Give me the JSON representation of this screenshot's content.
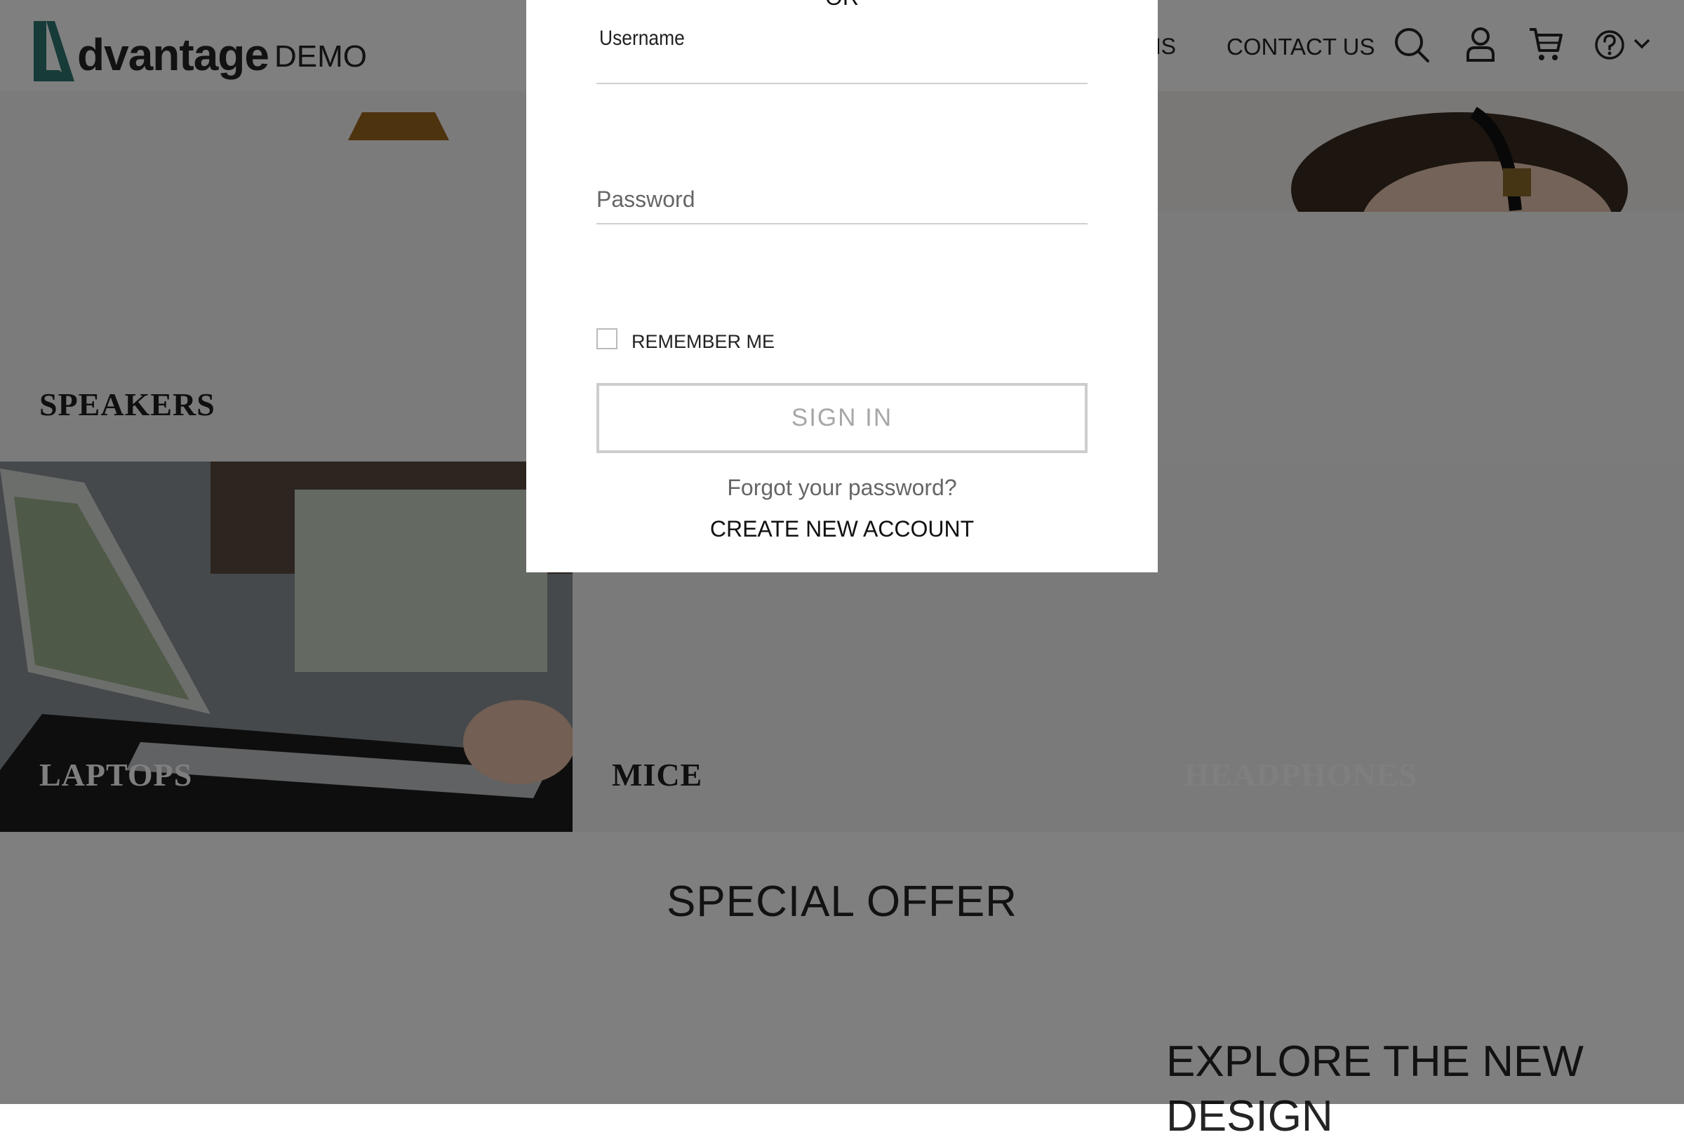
{
  "header": {
    "logo_word": "dvantage",
    "logo_demo": "DEMO",
    "nav_partial": "MS",
    "nav_contact": "CONTACT US",
    "icons": [
      "search-icon",
      "user-icon",
      "cart-icon",
      "help-icon",
      "chevron-down-icon"
    ],
    "accent_color": "#2f7770"
  },
  "categories": {
    "speakers": "SPEAKERS",
    "laptops": "LAPTOPS",
    "mice": "MICE",
    "headphones": "HEADPHONES"
  },
  "sections": {
    "special_offer": "SPECIAL OFFER",
    "explore_line1": "EXPLORE THE NEW",
    "explore_line2": "DESIGN"
  },
  "login_modal": {
    "or_text": "OR",
    "username_label": "Username",
    "username_value": "",
    "password_placeholder": "Password",
    "password_value": "",
    "remember_me": "REMEMBER ME",
    "remember_checked": false,
    "sign_in": "SIGN IN",
    "forgot": "Forgot your password?",
    "create_account": "CREATE NEW ACCOUNT"
  }
}
